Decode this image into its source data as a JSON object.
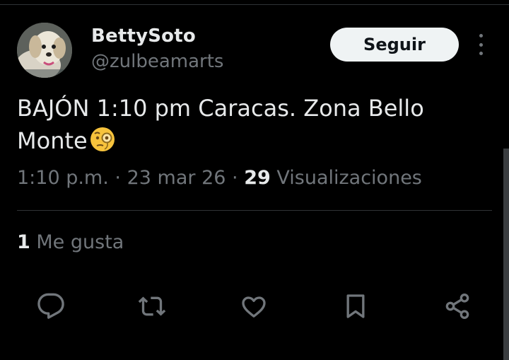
{
  "author": {
    "display_name": "BettySoto",
    "handle": "@zulbeamarts"
  },
  "follow_label": "Seguir",
  "tweet": {
    "text": "BAJÓN 1:10  pm  Caracas. Zona Bello Monte",
    "emoji_name": "face-with-monocle"
  },
  "meta": {
    "time": "1:10 p.m.",
    "separator": "·",
    "date": "23 mar 26",
    "views_count": "29",
    "views_label": "Visualizaciones"
  },
  "likes": {
    "count": "1",
    "label": "Me gusta"
  },
  "actions": [
    {
      "icon": "reply-icon"
    },
    {
      "icon": "retweet-icon"
    },
    {
      "icon": "like-icon"
    },
    {
      "icon": "bookmark-icon"
    },
    {
      "icon": "share-icon"
    }
  ],
  "colors": {
    "background": "#000000",
    "text_primary": "#e7e9ea",
    "text_secondary": "#71767b",
    "divider": "#2f3336",
    "follow_button_bg": "#eff3f4"
  }
}
